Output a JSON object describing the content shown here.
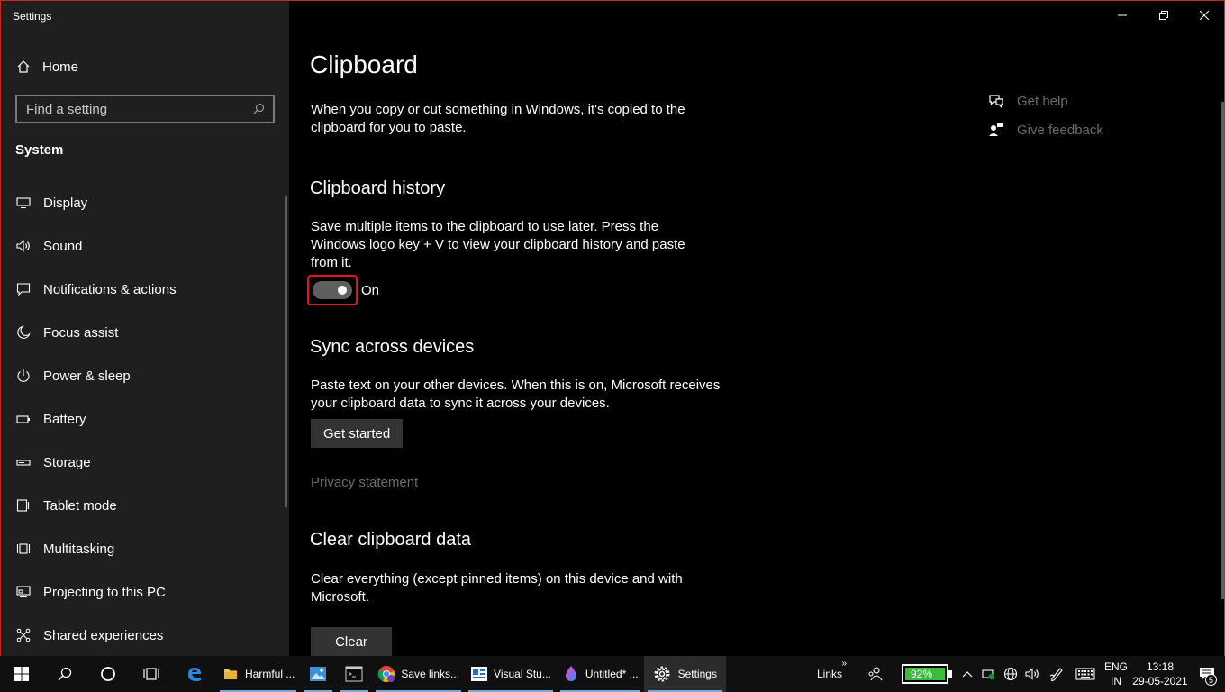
{
  "window": {
    "title": "Settings"
  },
  "sidebar": {
    "home_label": "Home",
    "search_placeholder": "Find a setting",
    "section_title": "System",
    "items": [
      {
        "label": "Display",
        "icon": "display-icon"
      },
      {
        "label": "Sound",
        "icon": "sound-icon"
      },
      {
        "label": "Notifications & actions",
        "icon": "notifications-icon"
      },
      {
        "label": "Focus assist",
        "icon": "moon-icon"
      },
      {
        "label": "Power & sleep",
        "icon": "power-icon"
      },
      {
        "label": "Battery",
        "icon": "battery-icon"
      },
      {
        "label": "Storage",
        "icon": "storage-icon"
      },
      {
        "label": "Tablet mode",
        "icon": "tablet-icon"
      },
      {
        "label": "Multitasking",
        "icon": "multitasking-icon"
      },
      {
        "label": "Projecting to this PC",
        "icon": "projecting-icon"
      },
      {
        "label": "Shared experiences",
        "icon": "shared-icon"
      }
    ]
  },
  "main": {
    "title": "Clipboard",
    "intro": "When you copy or cut something in Windows, it's copied to the clipboard for you to paste.",
    "history": {
      "heading": "Clipboard history",
      "description": "Save multiple items to the clipboard to use later. Press the Windows logo key + V to view your clipboard history and paste from it.",
      "toggle_state": "On"
    },
    "sync": {
      "heading": "Sync across devices",
      "description": "Paste text on your other devices. When this is on, Microsoft receives your clipboard data to sync it across your devices.",
      "button": "Get started",
      "privacy_link": "Privacy statement"
    },
    "clear": {
      "heading": "Clear clipboard data",
      "description": "Clear everything (except pinned items) on this device and with Microsoft.",
      "button": "Clear"
    },
    "help": {
      "get_help": "Get help",
      "give_feedback": "Give feedback"
    }
  },
  "taskbar": {
    "apps": [
      {
        "label": "Harmful ...",
        "icon": "folder-icon",
        "state": "open"
      },
      {
        "label": "",
        "icon": "photos-icon",
        "state": "open"
      },
      {
        "label": "",
        "icon": "terminal-icon",
        "state": "open"
      },
      {
        "label": "Save links...",
        "icon": "chrome-icon",
        "state": "open"
      },
      {
        "label": "Visual Stu...",
        "icon": "visual-studio-icon",
        "state": "open"
      },
      {
        "label": "Untitled* ...",
        "icon": "paint3d-icon",
        "state": "open"
      },
      {
        "label": "Settings",
        "icon": "settings-gear-icon",
        "state": "active"
      }
    ],
    "links_label": "Links",
    "battery_percent": "92%",
    "battery_level": 0.92,
    "language": {
      "line1": "ENG",
      "line2": "IN"
    },
    "time": "13:18",
    "date": "29-05-2021",
    "notification_count": "5"
  },
  "colors": {
    "window_border": "#c42b1c",
    "sidebar_bg": "#1f1f1f",
    "battery_fill": "#3dbb3d",
    "highlight": "#e81123"
  }
}
